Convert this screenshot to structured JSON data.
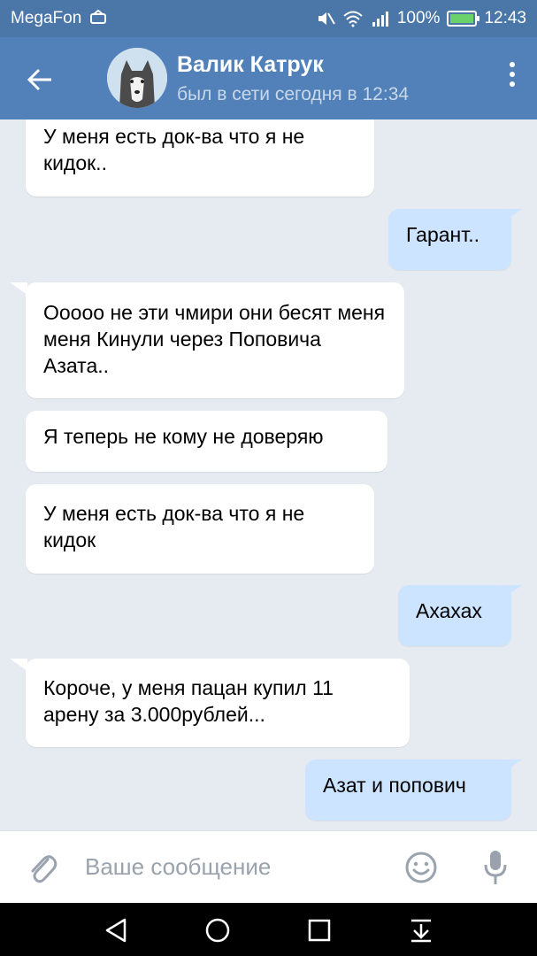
{
  "status_bar": {
    "carrier": "MegaFon",
    "battery": "100%",
    "time": "12:43"
  },
  "header": {
    "name": "Валик Катрук",
    "status": "был в сети сегодня в 12:34"
  },
  "messages": [
    {
      "dir": "in",
      "text": "У меня есть док-ва что я не кидок.."
    },
    {
      "dir": "out",
      "text": "Гарант.."
    },
    {
      "dir": "in",
      "text": "Ооооо не эти чмири они бесят меня меня Кинули через Поповича Азата.."
    },
    {
      "dir": "in",
      "text": "Я теперь не кому не доверяю"
    },
    {
      "dir": "in",
      "text": "У меня есть док-ва что я не кидок"
    },
    {
      "dir": "out",
      "text": "Ахахах"
    },
    {
      "dir": "in",
      "text": "Короче, у меня пацан купил 11 арену за 3.000рублей..."
    },
    {
      "dir": "out",
      "text": "Азат и попович"
    }
  ],
  "input": {
    "placeholder": "Ваше сообщение"
  },
  "icons": {
    "back": "arrow-left-icon",
    "menu": "more-vertical-icon",
    "attach": "paperclip-icon",
    "emoji": "smiley-icon",
    "mic": "microphone-icon",
    "nav_back": "triangle-back-icon",
    "nav_home": "circle-home-icon",
    "nav_recent": "square-recent-icon",
    "nav_notifications": "pull-down-icon"
  },
  "colors": {
    "header": "#5181b8",
    "status_bar": "#4a76a8",
    "chat_bg": "#e6ebf1",
    "incoming": "#ffffff",
    "outgoing": "#cce4ff"
  }
}
